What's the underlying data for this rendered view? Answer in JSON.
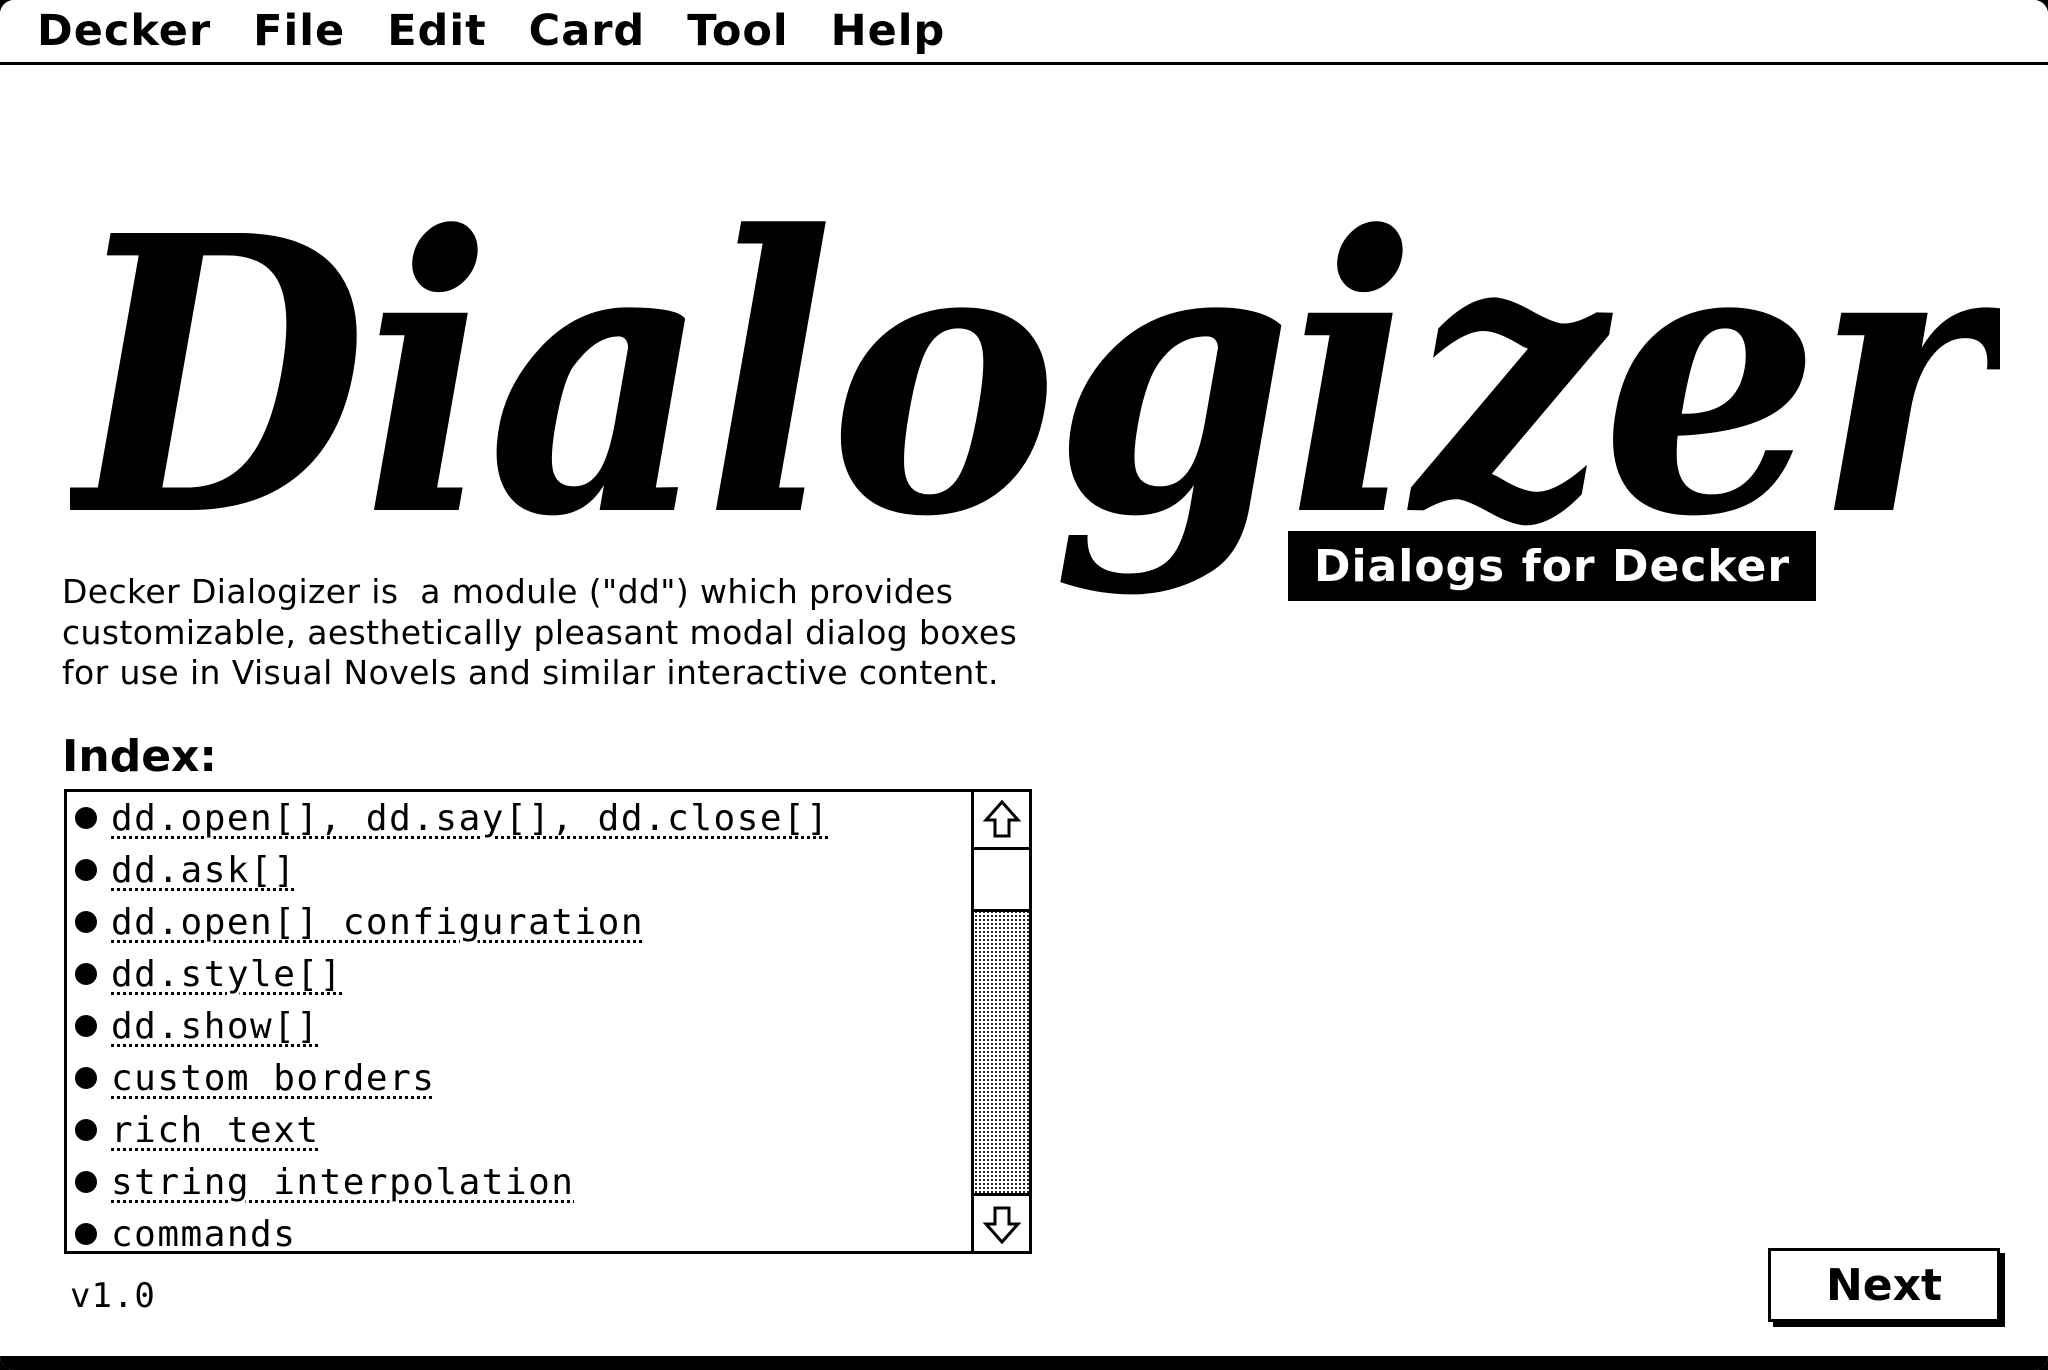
{
  "menubar": {
    "items": [
      "Decker",
      "File",
      "Edit",
      "Card",
      "Tool",
      "Help"
    ]
  },
  "logo": {
    "title": "Dialogizer",
    "tagline": "Dialogs for Decker"
  },
  "description": {
    "lines": [
      "Decker Dialogizer is  a module (\"dd\") which provides",
      "customizable, aesthetically pleasant modal dialog boxes",
      "for use in Visual Novels and similar interactive content."
    ]
  },
  "index": {
    "heading": "Index:",
    "items": [
      "dd.open[], dd.say[], dd.close[]",
      "dd.ask[]",
      "dd.open[] configuration",
      "dd.style[]",
      "dd.show[]",
      "custom borders",
      "rich text",
      "string interpolation",
      "commands"
    ],
    "scrollbar": {
      "up_icon": "up-arrow-icon",
      "down_icon": "down-arrow-icon",
      "position": 0
    }
  },
  "footer": {
    "version": "v1.0",
    "next_label": "Next"
  },
  "colors": {
    "foreground": "#000000",
    "background": "#ffffff"
  }
}
